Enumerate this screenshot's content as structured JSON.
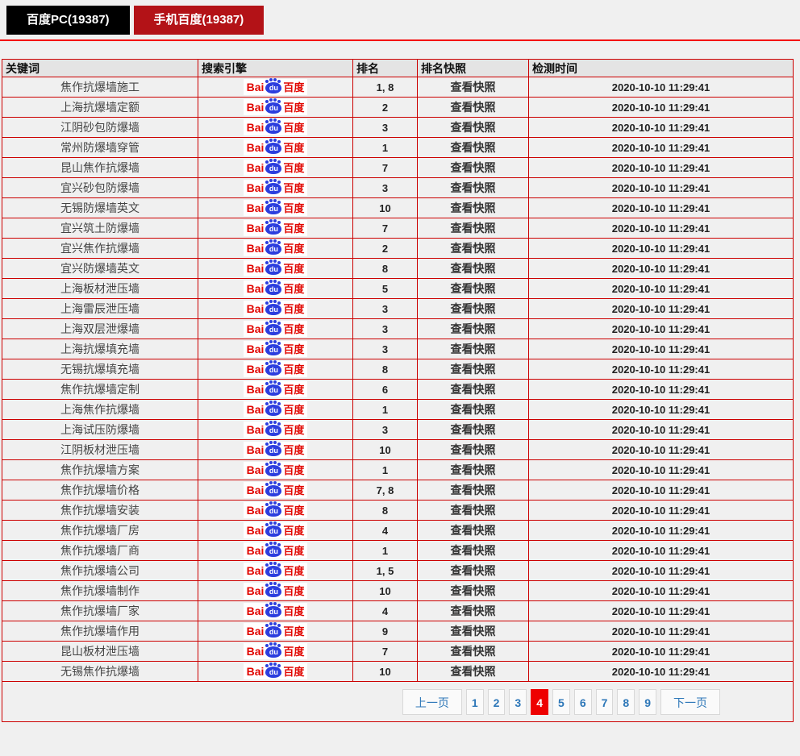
{
  "tabs": [
    {
      "label": "百度PC(19387)"
    },
    {
      "label": "手机百度(19387)"
    }
  ],
  "table": {
    "headers": [
      "关键词",
      "搜索引擎",
      "排名",
      "排名快照",
      "检测时间"
    ],
    "snapshot_label": "查看快照",
    "engine_logo": {
      "bai": "Bai",
      "du": "du",
      "cn": "百度"
    },
    "rows": [
      {
        "keyword": "焦作抗爆墙施工",
        "rank": "1, 8",
        "time": "2020-10-10 11:29:41"
      },
      {
        "keyword": "上海抗爆墙定额",
        "rank": "2",
        "time": "2020-10-10 11:29:41"
      },
      {
        "keyword": "江阴砂包防爆墙",
        "rank": "3",
        "time": "2020-10-10 11:29:41"
      },
      {
        "keyword": "常州防爆墙穿管",
        "rank": "1",
        "time": "2020-10-10 11:29:41"
      },
      {
        "keyword": "昆山焦作抗爆墙",
        "rank": "7",
        "time": "2020-10-10 11:29:41"
      },
      {
        "keyword": "宜兴砂包防爆墙",
        "rank": "3",
        "time": "2020-10-10 11:29:41"
      },
      {
        "keyword": "无锡防爆墙英文",
        "rank": "10",
        "time": "2020-10-10 11:29:41"
      },
      {
        "keyword": "宜兴筑土防爆墙",
        "rank": "7",
        "time": "2020-10-10 11:29:41"
      },
      {
        "keyword": "宜兴焦作抗爆墙",
        "rank": "2",
        "time": "2020-10-10 11:29:41"
      },
      {
        "keyword": "宜兴防爆墙英文",
        "rank": "8",
        "time": "2020-10-10 11:29:41"
      },
      {
        "keyword": "上海板材泄压墙",
        "rank": "5",
        "time": "2020-10-10 11:29:41"
      },
      {
        "keyword": "上海雷辰泄压墙",
        "rank": "3",
        "time": "2020-10-10 11:29:41"
      },
      {
        "keyword": "上海双层泄爆墙",
        "rank": "3",
        "time": "2020-10-10 11:29:41"
      },
      {
        "keyword": "上海抗爆填充墙",
        "rank": "3",
        "time": "2020-10-10 11:29:41"
      },
      {
        "keyword": "无锡抗爆填充墙",
        "rank": "8",
        "time": "2020-10-10 11:29:41"
      },
      {
        "keyword": "焦作抗爆墙定制",
        "rank": "6",
        "time": "2020-10-10 11:29:41"
      },
      {
        "keyword": "上海焦作抗爆墙",
        "rank": "1",
        "time": "2020-10-10 11:29:41"
      },
      {
        "keyword": "上海试压防爆墙",
        "rank": "3",
        "time": "2020-10-10 11:29:41"
      },
      {
        "keyword": "江阴板材泄压墙",
        "rank": "10",
        "time": "2020-10-10 11:29:41"
      },
      {
        "keyword": "焦作抗爆墙方案",
        "rank": "1",
        "time": "2020-10-10 11:29:41"
      },
      {
        "keyword": "焦作抗爆墙价格",
        "rank": "7, 8",
        "time": "2020-10-10 11:29:41"
      },
      {
        "keyword": "焦作抗爆墙安装",
        "rank": "8",
        "time": "2020-10-10 11:29:41"
      },
      {
        "keyword": "焦作抗爆墙厂房",
        "rank": "4",
        "time": "2020-10-10 11:29:41"
      },
      {
        "keyword": "焦作抗爆墙厂商",
        "rank": "1",
        "time": "2020-10-10 11:29:41"
      },
      {
        "keyword": "焦作抗爆墙公司",
        "rank": "1, 5",
        "time": "2020-10-10 11:29:41"
      },
      {
        "keyword": "焦作抗爆墙制作",
        "rank": "10",
        "time": "2020-10-10 11:29:41"
      },
      {
        "keyword": "焦作抗爆墙厂家",
        "rank": "4",
        "time": "2020-10-10 11:29:41"
      },
      {
        "keyword": "焦作抗爆墙作用",
        "rank": "9",
        "time": "2020-10-10 11:29:41"
      },
      {
        "keyword": "昆山板材泄压墙",
        "rank": "7",
        "time": "2020-10-10 11:29:41"
      },
      {
        "keyword": "无锡焦作抗爆墙",
        "rank": "10",
        "time": "2020-10-10 11:29:41"
      }
    ]
  },
  "pagination": {
    "prev": "上一页",
    "next": "下一页",
    "pages": [
      "1",
      "2",
      "3",
      "4",
      "5",
      "6",
      "7",
      "8",
      "9"
    ],
    "active": "4"
  },
  "colors": {
    "tab_inactive_bg": "#000000",
    "tab_active_bg": "#b31217",
    "divider_red": "#f40000",
    "table_border_red": "#cc0000",
    "baidu_red": "#e10601",
    "baidu_blue": "#2c3ede",
    "pagination_link": "#2d77b8",
    "pagination_active_bg": "#ee0000"
  }
}
